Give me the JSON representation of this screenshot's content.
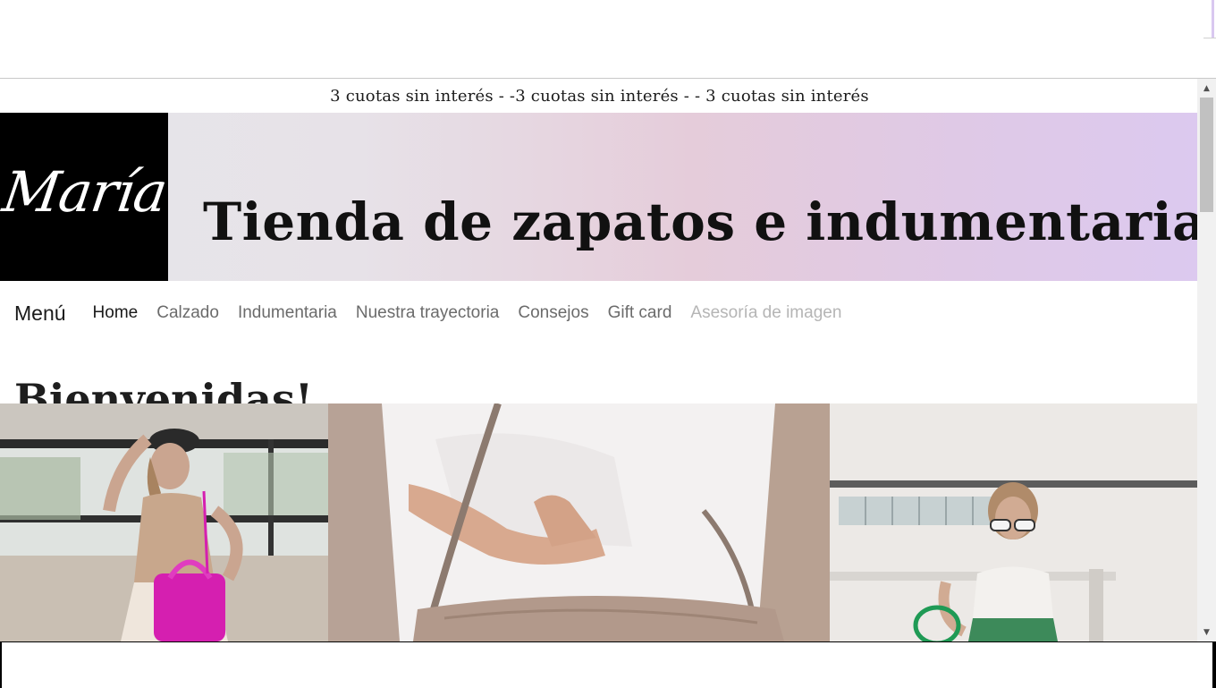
{
  "promo": {
    "text": "3 cuotas sin interés - -3 cuotas sin interés - - 3 cuotas sin interés"
  },
  "banner": {
    "logo_text": "María",
    "title": "Tienda de zapatos e indumentaria",
    "gradient_colors": [
      "#e6e6ea",
      "#e5ccda",
      "#dcc9ef"
    ]
  },
  "navbar": {
    "brand": "Menú",
    "links": [
      {
        "label": "Home",
        "state": "active"
      },
      {
        "label": "Calzado",
        "state": "normal"
      },
      {
        "label": "Indumentaria",
        "state": "normal"
      },
      {
        "label": "Nuestra trayectoria",
        "state": "normal"
      },
      {
        "label": "Consejos",
        "state": "normal"
      },
      {
        "label": "Gift card",
        "state": "normal"
      },
      {
        "label": "Asesoría de imagen",
        "state": "disabled"
      }
    ]
  },
  "page": {
    "heading": "Bienvenidas!"
  },
  "gallery": {
    "photos": [
      {
        "subject": "woman-cap-pink-bag-photo"
      },
      {
        "subject": "shoulder-bag-closeup-photo"
      },
      {
        "subject": "woman-sunglasses-green-bag-photo"
      }
    ]
  }
}
